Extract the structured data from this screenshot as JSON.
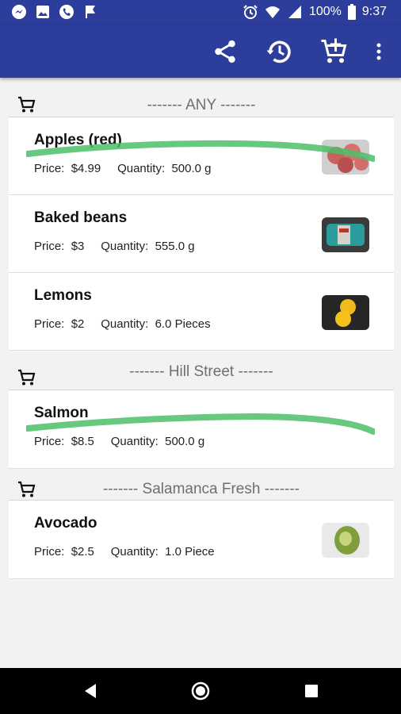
{
  "status_bar": {
    "battery": "100%",
    "time": "9:37",
    "left_icons": [
      "messenger-icon",
      "gallery-icon",
      "phone-icon",
      "flag-icon"
    ],
    "right_icons": [
      "alarm-icon",
      "wifi-icon",
      "signal-icon",
      "battery-icon"
    ]
  },
  "app_bar": {
    "actions": [
      "share-icon",
      "history-icon",
      "add-to-cart-icon",
      "overflow-menu-icon"
    ],
    "color": "#2c3d9b"
  },
  "groups": [
    {
      "title": "------- ANY -------",
      "items": [
        {
          "name": "Apples (red)",
          "price_label": "Price:",
          "price": "$4.99",
          "quantity_label": "Quantity:",
          "quantity": "500.0 g",
          "crossed_out": true
        },
        {
          "name": "Baked beans",
          "price_label": "Price:",
          "price": "$3",
          "quantity_label": "Quantity:",
          "quantity": "555.0 g",
          "crossed_out": false
        },
        {
          "name": "Lemons",
          "price_label": "Price:",
          "price": "$2",
          "quantity_label": "Quantity:",
          "quantity": "6.0 Pieces",
          "crossed_out": false
        }
      ]
    },
    {
      "title": "------- Hill Street -------",
      "items": [
        {
          "name": "Salmon",
          "price_label": "Price:",
          "price": "$8.5",
          "quantity_label": "Quantity:",
          "quantity": "500.0 g",
          "crossed_out": true
        }
      ]
    },
    {
      "title": "------- Salamanca Fresh -------",
      "items": [
        {
          "name": "Avocado",
          "price_label": "Price:",
          "price": "$2.5",
          "quantity_label": "Quantity:",
          "quantity": "1.0 Piece",
          "crossed_out": false
        }
      ]
    }
  ],
  "strike_color": "#4cc06a",
  "nav_bar": [
    "back-icon",
    "home-icon",
    "recents-icon"
  ]
}
